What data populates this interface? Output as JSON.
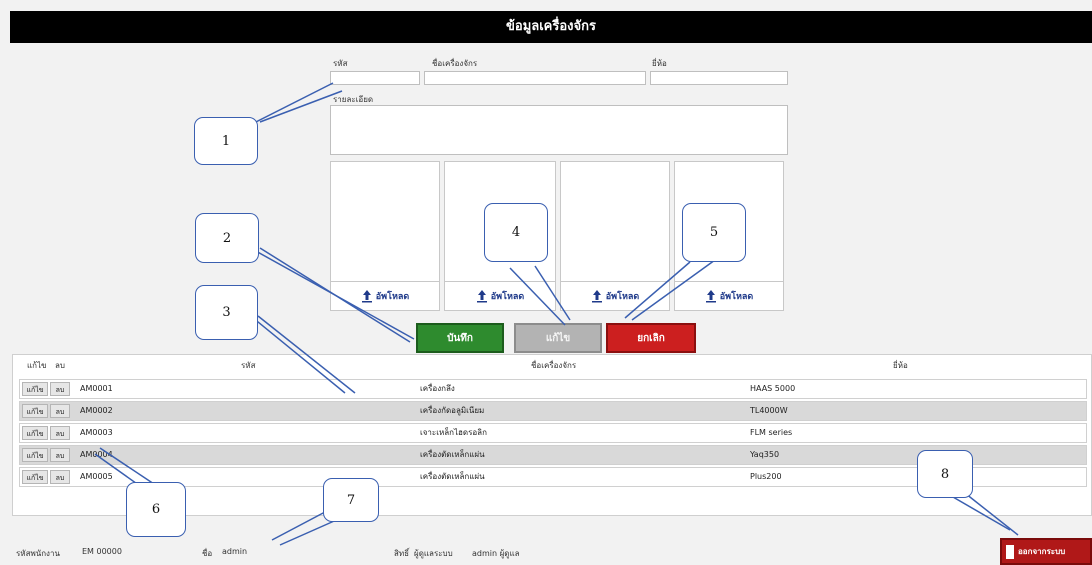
{
  "window": {
    "title": "ข้อมูลเครื่องจักร"
  },
  "form": {
    "code_label": "รหัส",
    "name_label": "ชื่อเครื่องจักร",
    "brand_label": "ยี่ห้อ",
    "detail_label": "รายละเอียด",
    "upload_label": "อัพโหลด"
  },
  "buttons": {
    "save": "บันทึก",
    "edit": "แก้ไข",
    "cancel": "ยกเลิก"
  },
  "table": {
    "headers": [
      "แก้ไข",
      "ลบ",
      "รหัส",
      "ชื่อเครื่องจักร",
      "ยี่ห้อ"
    ],
    "edit_label": "แก้ไข",
    "delete_label": "ลบ",
    "rows": [
      {
        "code": "AM0001",
        "name": "เครื่องกลึง",
        "brand": "HAAS 5000"
      },
      {
        "code": "AM0002",
        "name": "เครื่องกัดอลูมิเนียม",
        "brand": "TL4000W"
      },
      {
        "code": "AM0003",
        "name": "เจาะเหล็กไฮดรอลิก",
        "brand": "FLM series"
      },
      {
        "code": "AM0004",
        "name": "เครื่องตัดเหล็กแผ่น",
        "brand": "Yaq350"
      },
      {
        "code": "AM0005",
        "name": "เครื่องตัดเหล็กแผ่น",
        "brand": "Plus200"
      }
    ]
  },
  "footer": {
    "label1": "รหัสพนักงาน",
    "value1": "EM 00000",
    "label2": "ชื่อ",
    "value2": "admin",
    "label3": "สิทธิ์",
    "value3": "ผู้ดูแลระบบ",
    "value4": "admin ผู้ดูแล",
    "exit": "ออกจากระบบ"
  },
  "callouts": [
    "1",
    "2",
    "3",
    "4",
    "5",
    "6",
    "7",
    "8"
  ],
  "colors": {
    "save": "#2e8b2e",
    "edit": "#b3b3b3",
    "cancel": "#cc1f1f",
    "title_bg": "#000000",
    "callout_border": "#3a5fb0"
  },
  "icons": {
    "upload": "upload-arrow-icon",
    "exit": "door-exit-icon"
  }
}
